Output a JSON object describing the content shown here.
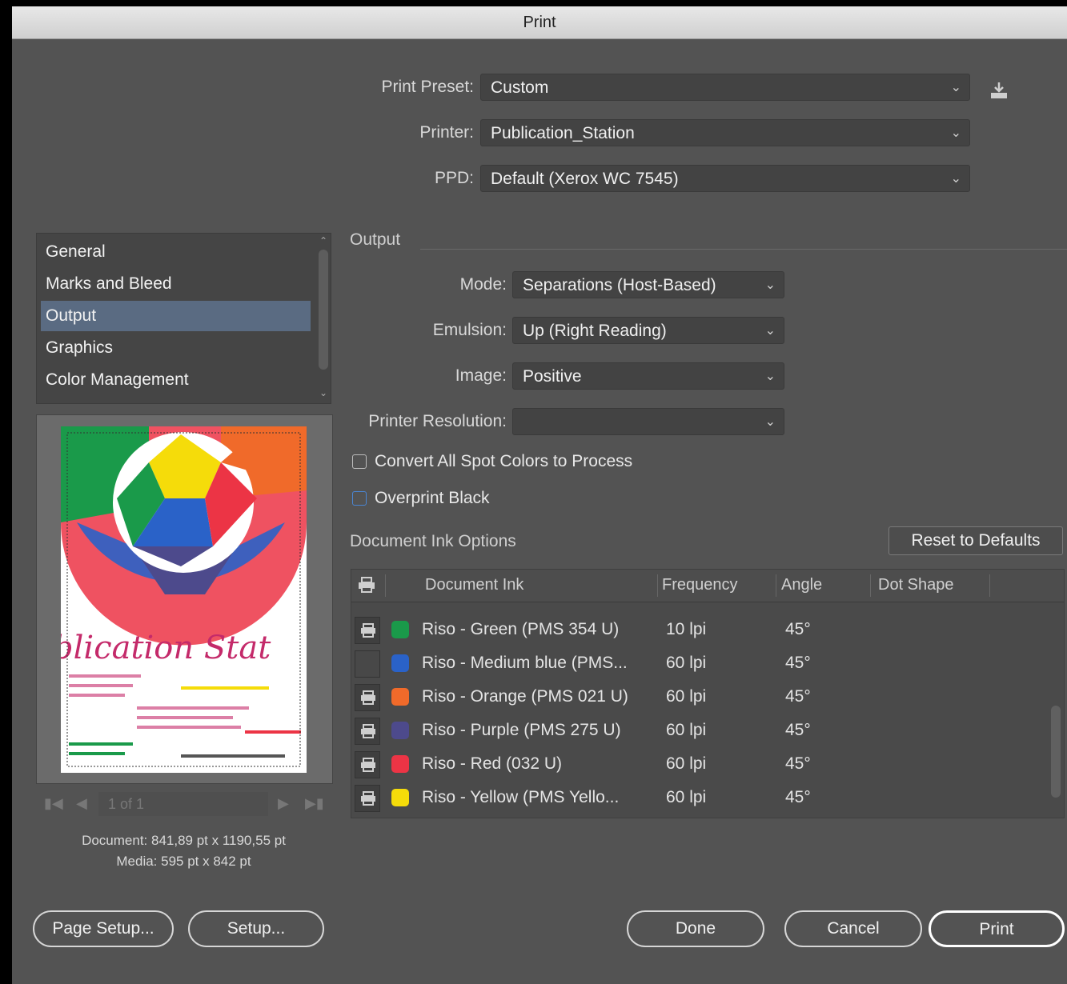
{
  "window": {
    "title": "Print"
  },
  "top": {
    "preset": {
      "label": "Print Preset:",
      "value": "Custom"
    },
    "printer": {
      "label": "Printer:",
      "value": "Publication_Station"
    },
    "ppd": {
      "label": "PPD:",
      "value": "Default (Xerox WC 7545)"
    }
  },
  "sidebar": {
    "items": [
      {
        "label": "General"
      },
      {
        "label": "Marks and Bleed"
      },
      {
        "label": "Output",
        "selected": true
      },
      {
        "label": "Graphics"
      },
      {
        "label": "Color Management"
      }
    ]
  },
  "preview": {
    "poster_text": "blication Stat",
    "page_field": "1 of 1",
    "document_size": "Document: 841,89 pt x 1190,55 pt",
    "media_size": "Media: 595 pt x 842 pt"
  },
  "output": {
    "section_title": "Output",
    "mode": {
      "label": "Mode:",
      "value": "Separations (Host-Based)"
    },
    "emulsion": {
      "label": "Emulsion:",
      "value": "Up (Right Reading)"
    },
    "image": {
      "label": "Image:",
      "value": "Positive"
    },
    "resolution": {
      "label": "Printer Resolution:",
      "value": ""
    },
    "convert_spot": {
      "label": "Convert All Spot Colors to Process",
      "checked": false
    },
    "overprint_black": {
      "label": "Overprint Black",
      "checked": false
    }
  },
  "ink_options": {
    "title": "Document Ink Options",
    "reset_label": "Reset to Defaults",
    "headers": {
      "ink": "Document Ink",
      "frequency": "Frequency",
      "angle": "Angle",
      "dot_shape": "Dot Shape"
    },
    "rows": [
      {
        "print": true,
        "color": "#1a9a4a",
        "name": "Riso - Green (PMS 354 U)",
        "frequency": "10 lpi",
        "angle": "45°"
      },
      {
        "print": false,
        "color": "#2a62c8",
        "name": "Riso - Medium blue (PMS...",
        "frequency": "60 lpi",
        "angle": "45°"
      },
      {
        "print": true,
        "color": "#f06a2a",
        "name": "Riso - Orange (PMS 021 U)",
        "frequency": "60 lpi",
        "angle": "45°"
      },
      {
        "print": true,
        "color": "#4d4a8c",
        "name": "Riso - Purple (PMS 275 U)",
        "frequency": "60 lpi",
        "angle": "45°"
      },
      {
        "print": true,
        "color": "#ec3445",
        "name": "Riso - Red (032 U)",
        "frequency": "60 lpi",
        "angle": "45°"
      },
      {
        "print": true,
        "color": "#f5dc0a",
        "name": "Riso - Yellow (PMS Yello...",
        "frequency": "60 lpi",
        "angle": "45°"
      }
    ]
  },
  "buttons": {
    "page_setup": "Page Setup...",
    "setup": "Setup...",
    "done": "Done",
    "cancel": "Cancel",
    "print": "Print"
  }
}
